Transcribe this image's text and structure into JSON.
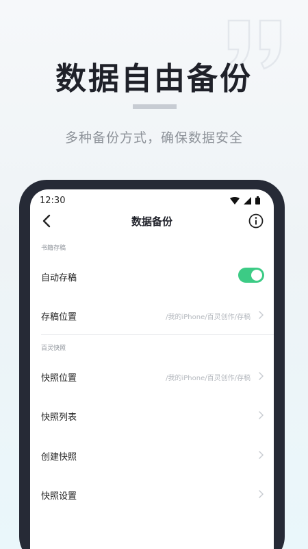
{
  "promo": {
    "headline": "数据自由备份",
    "subheadline": "多种备份方式，确保数据安全"
  },
  "status_bar": {
    "time": "12:30",
    "icons": [
      "wifi-icon",
      "signal-icon",
      "battery-icon"
    ]
  },
  "nav": {
    "title": "数据备份",
    "back_icon": "chevron-left-icon",
    "info_icon": "info-icon"
  },
  "sections": {
    "manuscripts": {
      "label": "书籍存稿",
      "auto_save": {
        "label": "自动存稿",
        "enabled": true
      },
      "location": {
        "label": "存稿位置",
        "value": "/我的iPhone/百灵创作/存稿"
      }
    },
    "snapshots": {
      "label": "百灵快照",
      "location": {
        "label": "快照位置",
        "value": "/我的iPhone/百灵创作/存稿"
      },
      "list": {
        "label": "快照列表"
      },
      "create": {
        "label": "创建快照"
      },
      "settings": {
        "label": "快照设置"
      }
    }
  },
  "colors": {
    "toggle_on": "#3ccb85",
    "phone_frame": "#262a36",
    "headline": "#1f2129"
  }
}
